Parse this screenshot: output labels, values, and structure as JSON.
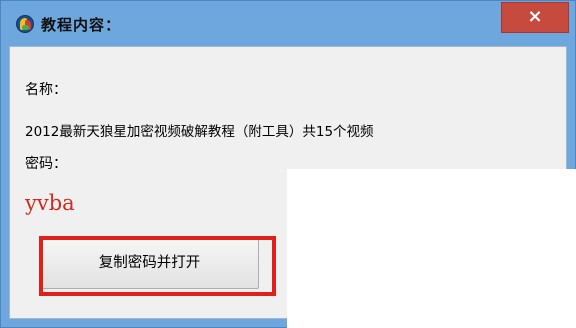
{
  "window": {
    "title": "教程内容：",
    "close_label": "×"
  },
  "content": {
    "name_label": "名称：",
    "name_value": "2012最新天狼星加密视频破解教程（附工具）共15个视频",
    "password_label": "密码：",
    "password_value": "yvba",
    "copy_button_label": "复制密码并打开"
  },
  "colors": {
    "title_bar": "#6ea7dd",
    "close_button": "#c74a3f",
    "password_text": "#d22a1e",
    "highlight_border": "#e0201a"
  },
  "icons": {
    "app_icon": "app-logo-icon"
  }
}
